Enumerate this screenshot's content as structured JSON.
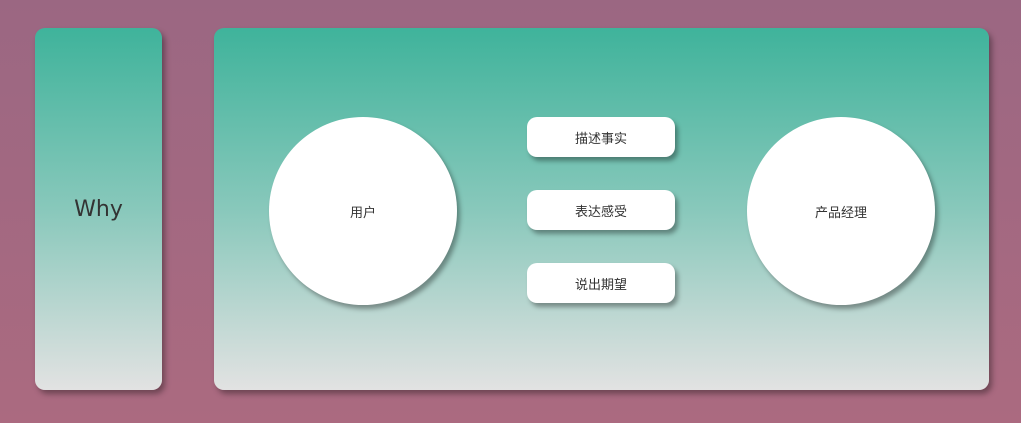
{
  "left_panel": {
    "label": "Why"
  },
  "diagram": {
    "left_node": "用户",
    "right_node": "产品经理",
    "actions": [
      "描述事实",
      "表达感受",
      "说出期望"
    ]
  },
  "colors": {
    "background_top": "#9b6782",
    "background_bottom": "#ab6a80",
    "panel_top": "#3fb39b",
    "panel_bottom": "#e2e2e2",
    "node_fill": "#ffffff",
    "text": "#333333"
  }
}
